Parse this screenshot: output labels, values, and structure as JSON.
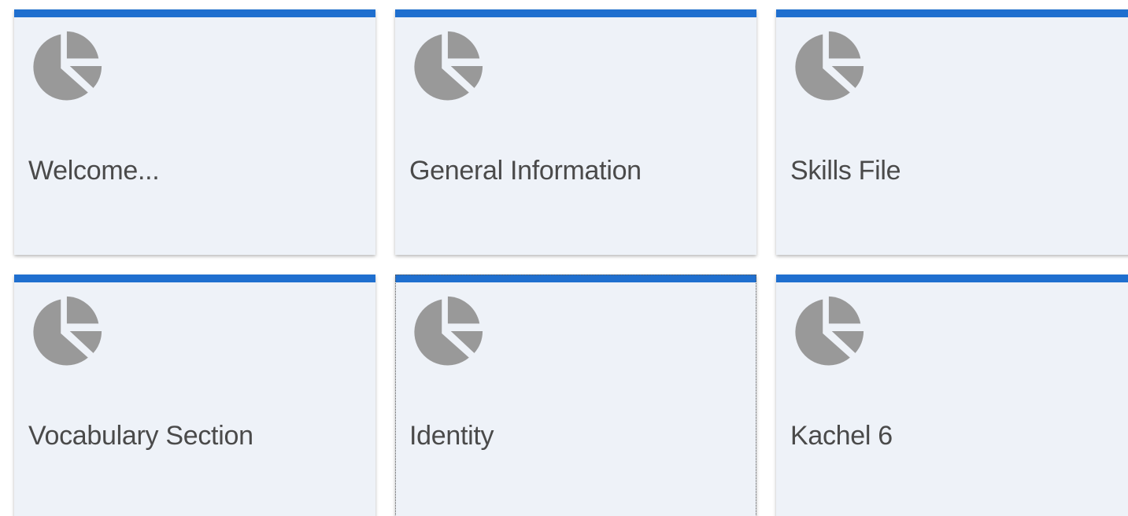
{
  "tiles": [
    {
      "label": "Welcome...",
      "icon": "pie-chart-icon"
    },
    {
      "label": "General Information",
      "icon": "pie-chart-icon"
    },
    {
      "label": "Skills File",
      "icon": "pie-chart-icon"
    },
    {
      "label": "Vocabulary Section",
      "icon": "pie-chart-icon"
    },
    {
      "label": "Identity",
      "icon": "pie-chart-icon"
    },
    {
      "label": "Kachel 6",
      "icon": "pie-chart-icon"
    }
  ],
  "colors": {
    "accent": "#1f6fcf",
    "tile_background": "#eef2f8",
    "icon": "#999999",
    "text": "#4a4a4a"
  }
}
